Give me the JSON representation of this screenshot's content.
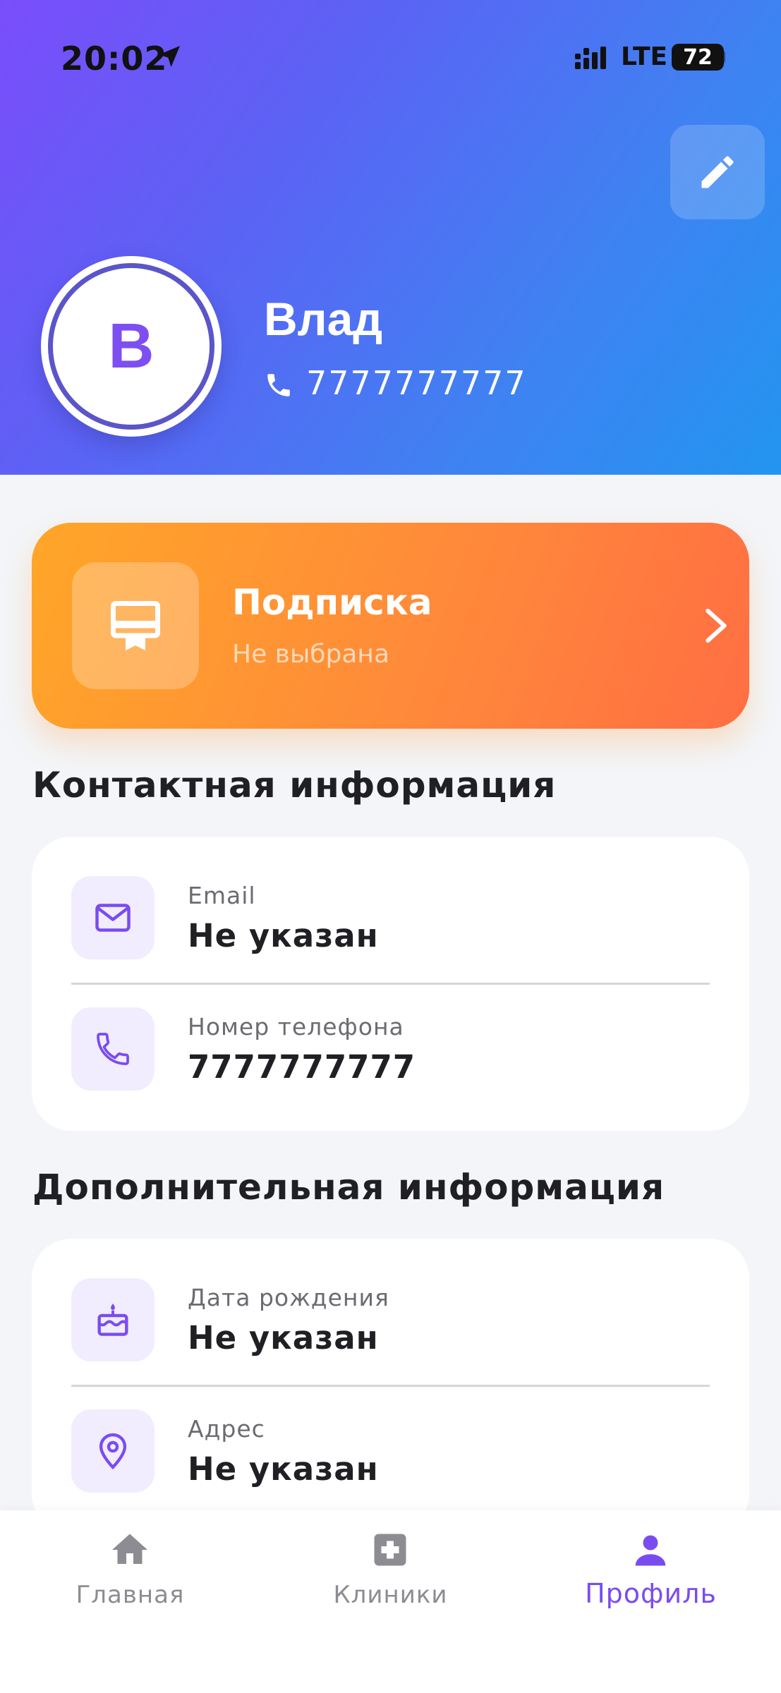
{
  "status_bar": {
    "time": "20:02",
    "network": "LTE",
    "battery": "72",
    "battery_level": 0.72
  },
  "profile": {
    "avatar_letter": "В",
    "name": "Влад",
    "phone": "7777777777"
  },
  "subscription": {
    "title": "Подписка",
    "status": "Не выбрана"
  },
  "contact_section": {
    "title": "Контактная информация",
    "rows": [
      {
        "icon": "mail-icon",
        "label": "Email",
        "value": "Не указан"
      },
      {
        "icon": "phone-icon",
        "label": "Номер телефона",
        "value": "7777777777"
      }
    ]
  },
  "additional_section": {
    "title": "Дополнительная информация",
    "rows": [
      {
        "icon": "cake-icon",
        "label": "Дата рождения",
        "value": "Не указан"
      },
      {
        "icon": "location-pin-icon",
        "label": "Адрес",
        "value": "Не указан"
      }
    ]
  },
  "bottom_nav": {
    "items": [
      {
        "icon": "home-icon",
        "label": "Главная",
        "active": false
      },
      {
        "icon": "medical-cross-icon",
        "label": "Клиники",
        "active": false
      },
      {
        "icon": "person-icon",
        "label": "Профиль",
        "active": true
      }
    ]
  },
  "colors": {
    "accent": "#7a4cf0",
    "header_gradient_start": "#7a4dfb",
    "header_gradient_end": "#2295f0",
    "subscription_gradient_start": "#ffa628",
    "subscription_gradient_end": "#ff6e43",
    "icon_bg": "#f1ecfe",
    "inactive_nav": "#8c8c92"
  }
}
